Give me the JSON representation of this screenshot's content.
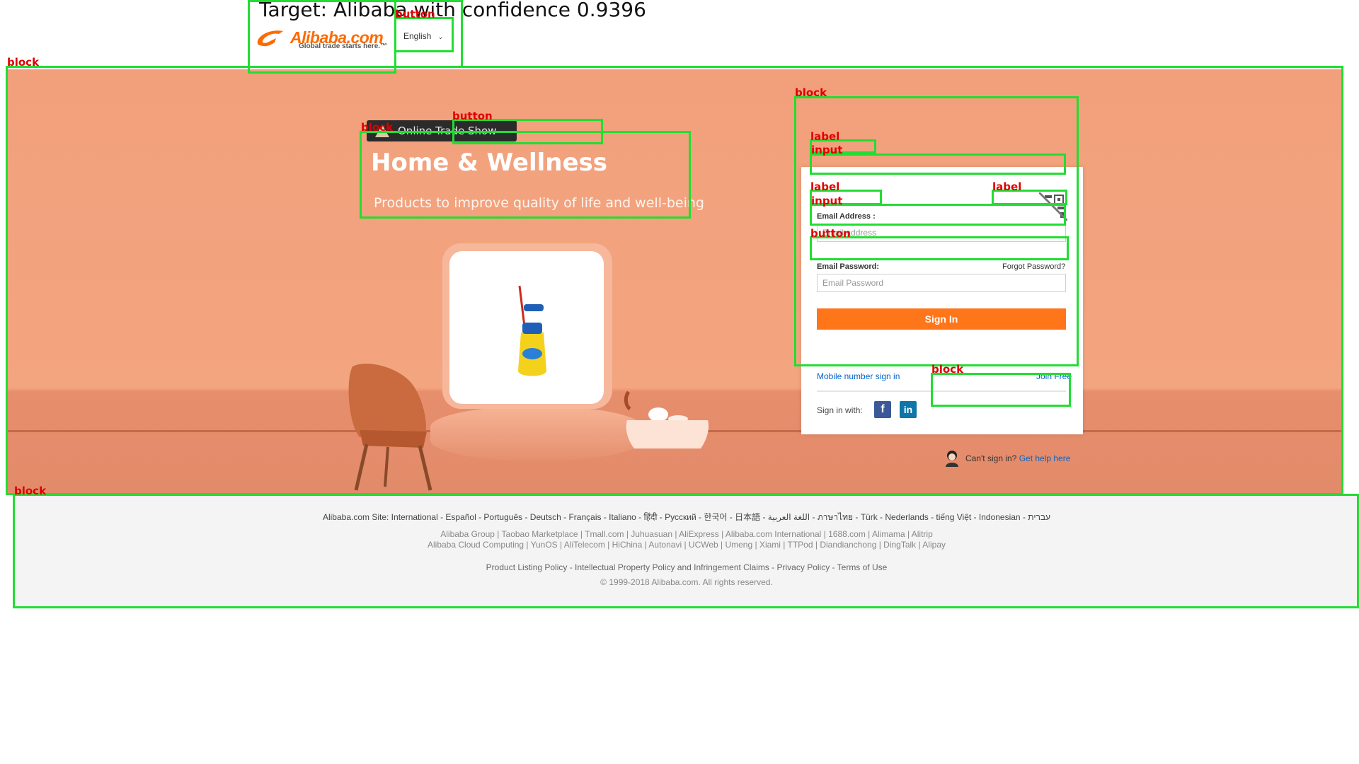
{
  "overlay": {
    "caption": "Target: Alibaba with confidence 0.9396",
    "tags": {
      "block": "block",
      "button": "button",
      "label": "label",
      "input": "input"
    }
  },
  "header": {
    "logo_word": "Alibaba.com",
    "logo_slogan": "Global trade starts here.™",
    "language": "English",
    "language_icon": "chevron-down-icon"
  },
  "hero": {
    "badge": "Online Trade Show",
    "title": "Home & Wellness",
    "subtitle": "Products to improve quality of life and well-being"
  },
  "login": {
    "email_label": "Email Address :",
    "email_placeholder": "Email address",
    "password_label": "Email Password:",
    "forgot": "Forgot Password?",
    "password_placeholder": "Email Password",
    "signin": "Sign In",
    "mobile": "Mobile number sign in",
    "join": "Join Free",
    "sign_with": "Sign in with:",
    "facebook": "f",
    "linkedin": "in",
    "qr_icon": "qr-code-icon"
  },
  "help": {
    "question": "Can't sign in?",
    "link": "Get help here"
  },
  "footer": {
    "sites": "Alibaba.com Site: International - Español - Português - Deutsch - Français - Italiano - हिंदी - Русский - 한국어 - 日本語 - اللغة العربية - ภาษาไทย - Türk - Nederlands - tiếng Việt - Indonesian - עברית",
    "group1": "Alibaba Group | Taobao Marketplace | Tmall.com | Juhuasuan | AliExpress | Alibaba.com International | 1688.com | Alimama | Alitrip",
    "group2": "Alibaba Cloud Computing | YunOS | AliTelecom | HiChina | Autonavi | UCWeb | Umeng | Xiami | TTPod | Diandianchong | DingTalk | Alipay",
    "policies": "Product Listing Policy - Intellectual Property Policy and Infringement Claims - Privacy Policy - Terms of Use",
    "copyright": "© 1999-2018 Alibaba.com. All rights reserved."
  },
  "colors": {
    "accent": "#ff7519",
    "hero_bg": "#f2a07c",
    "overlay_box": "#22dd33",
    "overlay_tag": "#e00000",
    "link": "#0066cc"
  }
}
